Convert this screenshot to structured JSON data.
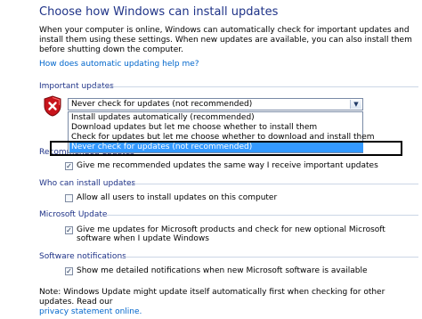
{
  "title": "Choose how Windows can install updates",
  "intro": "When your computer is online, Windows can automatically check for important updates and install them using these settings. When new updates are available, you can also install them before shutting down the computer.",
  "help_link": "How does automatic updating help me?",
  "important": {
    "heading": "Important updates",
    "selected": "Never check for updates (not recommended)",
    "options": [
      "Install updates automatically (recommended)",
      "Download updates but let me choose whether to install them",
      "Check for updates but let me choose whether to download and install them",
      "Never check for updates (not recommended)"
    ],
    "selected_index": 3
  },
  "recommended": {
    "heading": "Recommended updates",
    "checkbox_label": "Give me recommended updates the same way I receive important updates",
    "checked": true
  },
  "who": {
    "heading": "Who can install updates",
    "checkbox_label": "Allow all users to install updates on this computer",
    "checked": false
  },
  "microsoft": {
    "heading": "Microsoft Update",
    "checkbox_label": "Give me updates for Microsoft products and check for new optional Microsoft software when I update Windows",
    "checked": true
  },
  "notifications": {
    "heading": "Software notifications",
    "checkbox_label": "Show me detailed notifications when new Microsoft software is available",
    "checked": true
  },
  "note": {
    "text": "Note: Windows Update might update itself automatically first when checking for other updates.  Read our",
    "link": "privacy statement online."
  },
  "colors": {
    "heading": "#1e3287",
    "link": "#0066cc",
    "selection": "#3399ff"
  },
  "icons": {
    "shield": "red-shield-x-icon",
    "dropdown": "chevron-down-icon",
    "check": "checkmark-icon"
  }
}
